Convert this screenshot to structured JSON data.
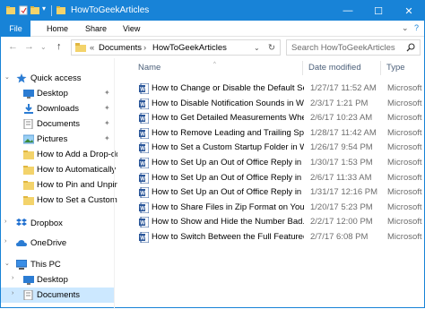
{
  "window": {
    "title": "HowToGeekArticles",
    "accent": "#1883d7",
    "minimize": "—",
    "maximize": "☐",
    "close": "✕"
  },
  "ribbon": {
    "tabs": [
      "File",
      "Home",
      "Share",
      "View"
    ],
    "expand": "⌄",
    "help": "?"
  },
  "address": {
    "back": "←",
    "forward": "→",
    "recent": "⌄",
    "up": "↑",
    "overflow": "«",
    "crumbs": [
      "Documents",
      "HowToGeekArticles"
    ],
    "sep": "›",
    "dropdown": "⌄",
    "refresh": "↻"
  },
  "search": {
    "placeholder": "Search HowToGeekArticles"
  },
  "nav": {
    "items": [
      {
        "label": "Quick access",
        "icon": "star-icon"
      },
      {
        "label": "Desktop",
        "icon": "desktop-icon",
        "pinned": true
      },
      {
        "label": "Downloads",
        "icon": "download-icon",
        "pinned": true
      },
      {
        "label": "Documents",
        "icon": "documents-icon",
        "pinned": true
      },
      {
        "label": "Pictures",
        "icon": "pictures-icon",
        "pinned": true
      },
      {
        "label": "How to Add a Drop-do",
        "icon": "folder-icon"
      },
      {
        "label": "How to Automatically",
        "icon": "folder-icon"
      },
      {
        "label": "How to Pin and Unpin",
        "icon": "folder-icon"
      },
      {
        "label": "How to Set a Custom S",
        "icon": "folder-icon"
      },
      {
        "label": "Dropbox",
        "icon": "dropbox-icon"
      },
      {
        "label": "OneDrive",
        "icon": "onedrive-icon"
      },
      {
        "label": "This PC",
        "icon": "pc-icon"
      },
      {
        "label": "Desktop",
        "icon": "desktop-icon"
      },
      {
        "label": "Documents",
        "icon": "documents-icon",
        "selected": true
      }
    ],
    "pin_glyph": "📌",
    "chevron": "›"
  },
  "columns": {
    "name": "Name",
    "date": "Date modified",
    "type": "Type",
    "sort": "^"
  },
  "files": [
    {
      "name": "How to Change or Disable the Default Se...",
      "date": "1/27/17 11:52 AM",
      "type": "Microsoft V"
    },
    {
      "name": "How to Disable Notification Sounds in W...",
      "date": "2/3/17 1:21 PM",
      "type": "Microsoft V"
    },
    {
      "name": "How to Get Detailed Measurements Whe...",
      "date": "2/6/17 10:23 AM",
      "type": "Microsoft V"
    },
    {
      "name": "How to Remove Leading and Trailing Spa...",
      "date": "1/28/17 11:42 AM",
      "type": "Microsoft V"
    },
    {
      "name": "How to Set a Custom Startup Folder in W...",
      "date": "1/26/17 9:54 PM",
      "type": "Microsoft V"
    },
    {
      "name": "How to Set Up an Out of Office Reply in ...",
      "date": "1/30/17 1:53 PM",
      "type": "Microsoft V"
    },
    {
      "name": "How to Set Up an Out of Office Reply in ...",
      "date": "2/6/17 11:33 AM",
      "type": "Microsoft V"
    },
    {
      "name": "How to Set Up an Out of Office Reply in ...",
      "date": "1/31/17 12:16 PM",
      "type": "Microsoft V"
    },
    {
      "name": "How to Share Files in Zip Format on Your...",
      "date": "1/20/17 5:23 PM",
      "type": "Microsoft V"
    },
    {
      "name": "How to Show and Hide the Number Bad...",
      "date": "2/2/17 12:00 PM",
      "type": "Microsoft V"
    },
    {
      "name": "How to Switch Between the Full Featured...",
      "date": "2/7/17 6:08 PM",
      "type": "Microsoft V"
    }
  ]
}
